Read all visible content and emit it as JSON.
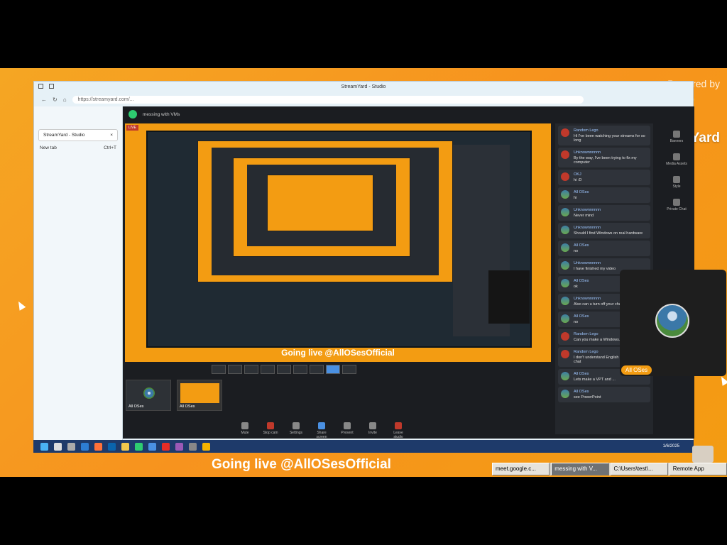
{
  "branding": {
    "powered_by": "Powered by",
    "brand": "StreamYard"
  },
  "banner": {
    "text": "Going live @AllOSesOfficial"
  },
  "browser": {
    "title": "StreamYard - Studio",
    "url": "https://streamyard.com/..."
  },
  "tabs": [
    {
      "label": "StreamYard - Studio",
      "close": "×"
    }
  ],
  "new_tab": {
    "label": "New tab",
    "shortcut": "Ctrl+T"
  },
  "studio": {
    "broadcast_title": "messing with VMs",
    "live_label": "LIVE",
    "canvas_banner": "Going live @AllOSesOfficial"
  },
  "chat": {
    "messages": [
      {
        "name": "Random Lego",
        "text": "Hi I've been watching your streams for so long",
        "avatar": "red"
      },
      {
        "name": "Unknownnnnnn",
        "text": "By the way, I've been trying to fix my computer",
        "avatar": "red"
      },
      {
        "name": "OKJ",
        "text": "hi :D",
        "avatar": "red"
      },
      {
        "name": "All OSes",
        "text": "hi",
        "avatar": "globe"
      },
      {
        "name": "Unknownnnnnn",
        "text": "Never mind",
        "avatar": "globe"
      },
      {
        "name": "Unknownnnnnn",
        "text": "Should I find Windows on real hardware",
        "avatar": "globe"
      },
      {
        "name": "All OSes",
        "text": "no",
        "avatar": "globe"
      },
      {
        "name": "Unknownnnnnn",
        "text": "I have finished my video",
        "avatar": "globe"
      },
      {
        "name": "All OSes",
        "text": "ok",
        "avatar": "globe"
      },
      {
        "name": "Unknownnnnnn",
        "text": "Also can u turn off your chat pls",
        "avatar": "globe"
      },
      {
        "name": "All OSes",
        "text": "no",
        "avatar": "globe"
      },
      {
        "name": "Random Lego",
        "text": "Can you make a Windows...",
        "avatar": "red"
      },
      {
        "name": "Random Lego",
        "text": "I don't understand English I type in the chat",
        "avatar": "red"
      },
      {
        "name": "All OSes",
        "text": "Lets make a VPT and ...",
        "avatar": "globe"
      },
      {
        "name": "All OSes",
        "text": "see PowerPoint",
        "avatar": "globe"
      }
    ]
  },
  "rail": [
    {
      "label": "Banners"
    },
    {
      "label": "Media Assets"
    },
    {
      "label": "Style"
    },
    {
      "label": "Private Chat"
    }
  ],
  "thumbs": [
    {
      "label": "All OSes"
    },
    {
      "label": "All OSes"
    }
  ],
  "controls": [
    {
      "label": "Mute",
      "kind": "normal"
    },
    {
      "label": "Stop cam",
      "kind": "red"
    },
    {
      "label": "Settings",
      "kind": "normal"
    },
    {
      "label": "Share screen",
      "kind": "blue"
    },
    {
      "label": "Present",
      "kind": "normal"
    },
    {
      "label": "Invite",
      "kind": "normal"
    },
    {
      "label": "Leave studio",
      "kind": "red"
    }
  ],
  "camera_tile": {
    "name": "All OSes"
  },
  "taskbar": {
    "clock": "1/6/2025"
  },
  "remote_tasks": [
    {
      "label": "meet.google.c..."
    },
    {
      "label": "messing with V..."
    },
    {
      "label": "C:\\Users\\test\\..."
    },
    {
      "label": "Remote App"
    }
  ],
  "colors": {
    "accent": "#f39c12",
    "live": "#c0392b",
    "studio_bg": "#1b1d21",
    "taskbar": "#1e3a6a"
  }
}
